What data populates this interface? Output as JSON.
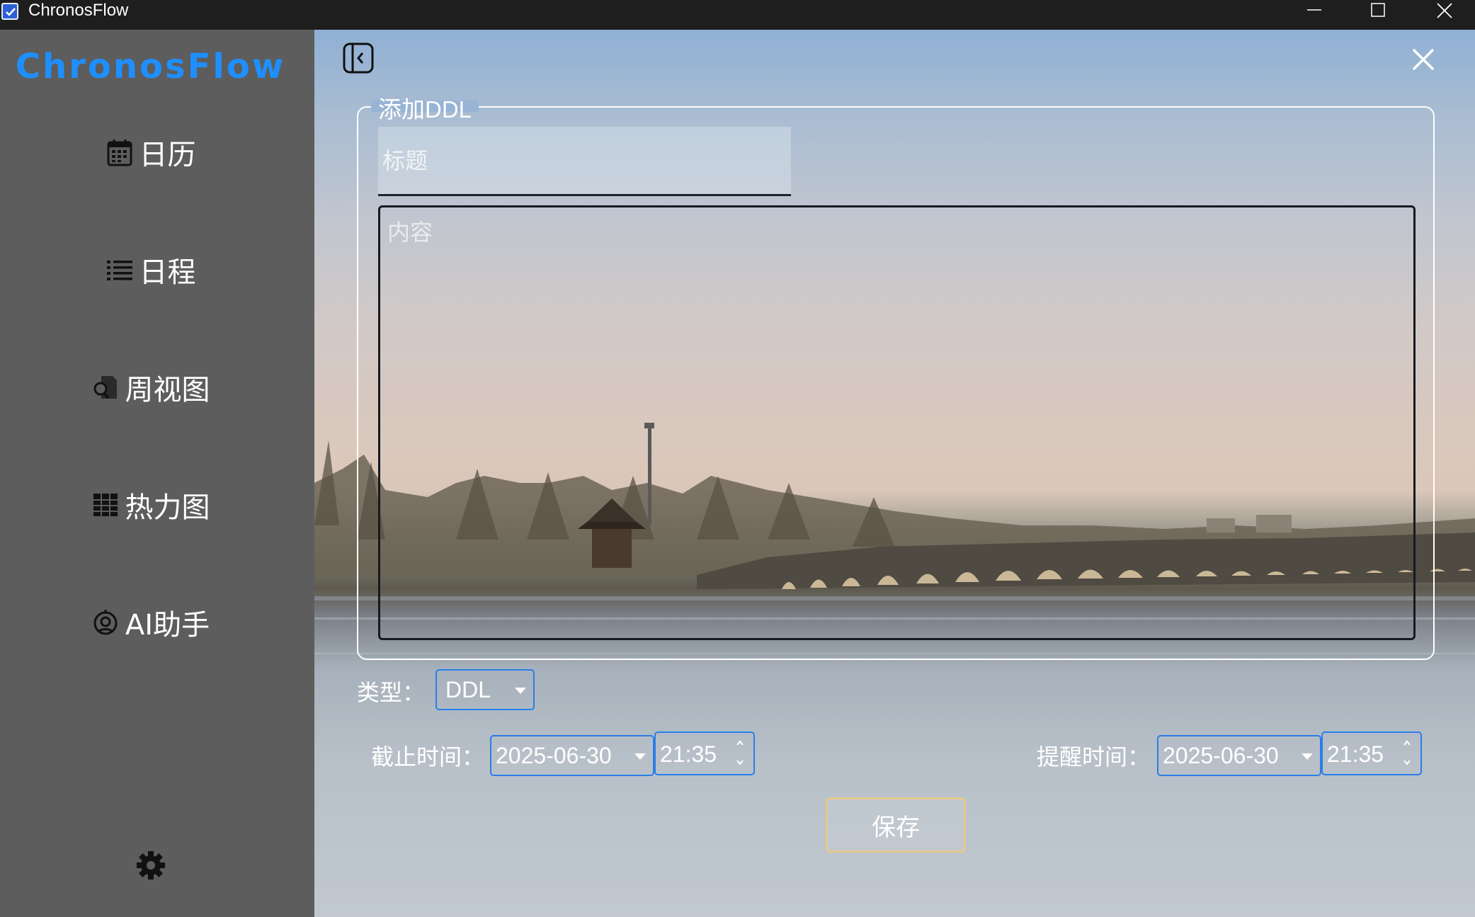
{
  "window": {
    "title": "ChronosFlow",
    "icon": "checkbox-app-icon",
    "controls": [
      "minimize-icon",
      "maximize-icon",
      "close-icon"
    ]
  },
  "sidebar": {
    "brand": "ChronosFlow",
    "brand_color": "#1e8fff",
    "background": "#5d5d5d",
    "items": [
      {
        "label": "日历",
        "icon": "calendar-icon"
      },
      {
        "label": "日程",
        "icon": "list-icon"
      },
      {
        "label": "周视图",
        "icon": "search-document-icon"
      },
      {
        "label": "热力图",
        "icon": "grid-icon"
      },
      {
        "label": "AI助手",
        "icon": "robot-icon"
      }
    ],
    "settings_icon": "gear-icon"
  },
  "form": {
    "legend": "添加DDL",
    "title_placeholder": "标题",
    "content_placeholder": "内容",
    "type_label": "类型：",
    "type_value": "DDL",
    "deadline_label": "截止时间：",
    "deadline_date": "2025-06-30",
    "deadline_time": "21:35",
    "reminder_label": "提醒时间：",
    "reminder_date": "2025-06-30",
    "reminder_time": "21:35",
    "save_label": "保存",
    "accent_color": "#2b7de9",
    "save_border_color": "#e6c98a"
  },
  "panel": {
    "collapse_icon": "collapse-panel-icon",
    "close_icon": "close-icon"
  }
}
